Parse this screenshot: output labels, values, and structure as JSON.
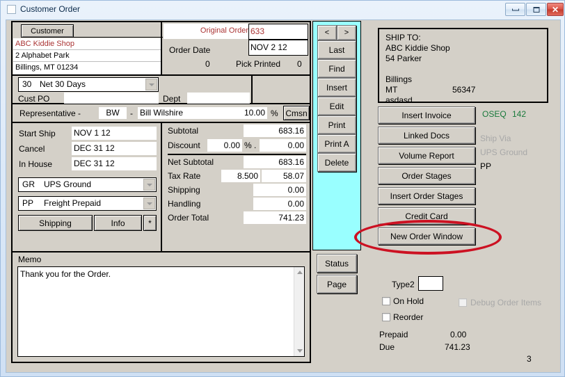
{
  "window": {
    "title": "Customer Order",
    "icon": "window-icon",
    "minimize": "minimize-icon",
    "maximize": "maximize-icon",
    "close": "✕"
  },
  "customer": {
    "tab_label": "Customer",
    "name": "ABC Kiddie Shop",
    "address": "2 Alphabet Park",
    "city_state_zip": "Billings, MT 01234"
  },
  "order_header": {
    "original_order_label": "Original Order",
    "original_order_value": "633",
    "order_date_label": "Order Date",
    "order_date_value": "NOV 2 12",
    "printed_count": "0",
    "pick_printed_label": "Pick Printed",
    "pick_printed_count": "0"
  },
  "terms": {
    "code": "30",
    "description": "Net 30 Days",
    "cust_po_label": "Cust PO",
    "cust_po_value": "",
    "dept_label": "Dept",
    "dept_value": ""
  },
  "representative": {
    "label": "Representative -",
    "code": "BW",
    "dash": "-",
    "name": "Bill Wilshire",
    "percent": "10.00",
    "percent_symbol": "%",
    "cmsn_button": "Cmsn"
  },
  "dates": {
    "start_ship_label": "Start Ship",
    "start_ship_value": "NOV 1 12",
    "cancel_label": "Cancel",
    "cancel_value": "DEC 31 12",
    "in_house_label": "In House",
    "in_house_value": "DEC 31 12"
  },
  "shipping_combos": {
    "ship_via_code": "GR",
    "ship_via_desc": "UPS Ground",
    "freight_code": "PP",
    "freight_desc": "Freight Prepaid",
    "shipping_button": "Shipping",
    "info_button": "Info",
    "star_button": "*"
  },
  "totals": {
    "subtotal_label": "Subtotal",
    "subtotal_value": "683.16",
    "discount_label": "Discount",
    "discount_percent": "0.00",
    "discount_symbol": "% .",
    "discount_value": "0.00",
    "net_subtotal_label": "Net Subtotal",
    "net_subtotal_value": "683.16",
    "tax_rate_label": "Tax Rate",
    "tax_rate_percent": "8.500",
    "tax_rate_value": "58.07",
    "shipping_label": "Shipping",
    "shipping_value": "0.00",
    "handling_label": "Handling",
    "handling_value": "0.00",
    "order_total_label": "Order Total",
    "order_total_value": "741.23"
  },
  "memo": {
    "label": "Memo",
    "text": "Thank you for the Order.",
    "scroll_up": "scroll-up-arrow",
    "scroll_down": "scroll-down-arrow"
  },
  "nav": {
    "prev": "<",
    "next": ">",
    "last": "Last",
    "find": "Find",
    "insert": "Insert",
    "edit": "Edit",
    "print": "Print",
    "print_a": "Print A",
    "delete": "Delete",
    "status": "Status",
    "page": "Page",
    "panel_color": "#99FFFF"
  },
  "ship_to": {
    "heading": "SHIP TO:",
    "name": "ABC Kiddie Shop",
    "street": "54 Parker",
    "blank": "",
    "city": "Billings",
    "state": "MT",
    "zip": "56347",
    "extra": "asdasd"
  },
  "actions": {
    "insert_invoice": "Insert Invoice",
    "linked_docs": "Linked Docs",
    "volume_report": "Volume Report",
    "order_stages": "Order Stages",
    "insert_order_stages": "Insert Order Stages",
    "credit_card": "Credit Card",
    "new_order_window": "New Order Window",
    "highlighted": "new_order_window",
    "highlight_color": "#cc1122"
  },
  "side_info": {
    "oseq_label": "OSEQ",
    "oseq_value": "142",
    "oseq_color": "#1a7a3c",
    "ship_via_label": "Ship Via",
    "ship_via_value": "UPS Ground",
    "freight_code": "PP"
  },
  "bottom": {
    "type2_label": "Type2",
    "type2_value": "",
    "on_hold_label": "On Hold",
    "on_hold_checked": false,
    "reorder_label": "Reorder",
    "reorder_checked": false,
    "debug_order_items_label": "Debug Order Items",
    "debug_order_items_checked": false,
    "prepaid_label": "Prepaid",
    "prepaid_value": "0.00",
    "due_label": "Due",
    "due_value": "741.23",
    "page_number": "3"
  }
}
